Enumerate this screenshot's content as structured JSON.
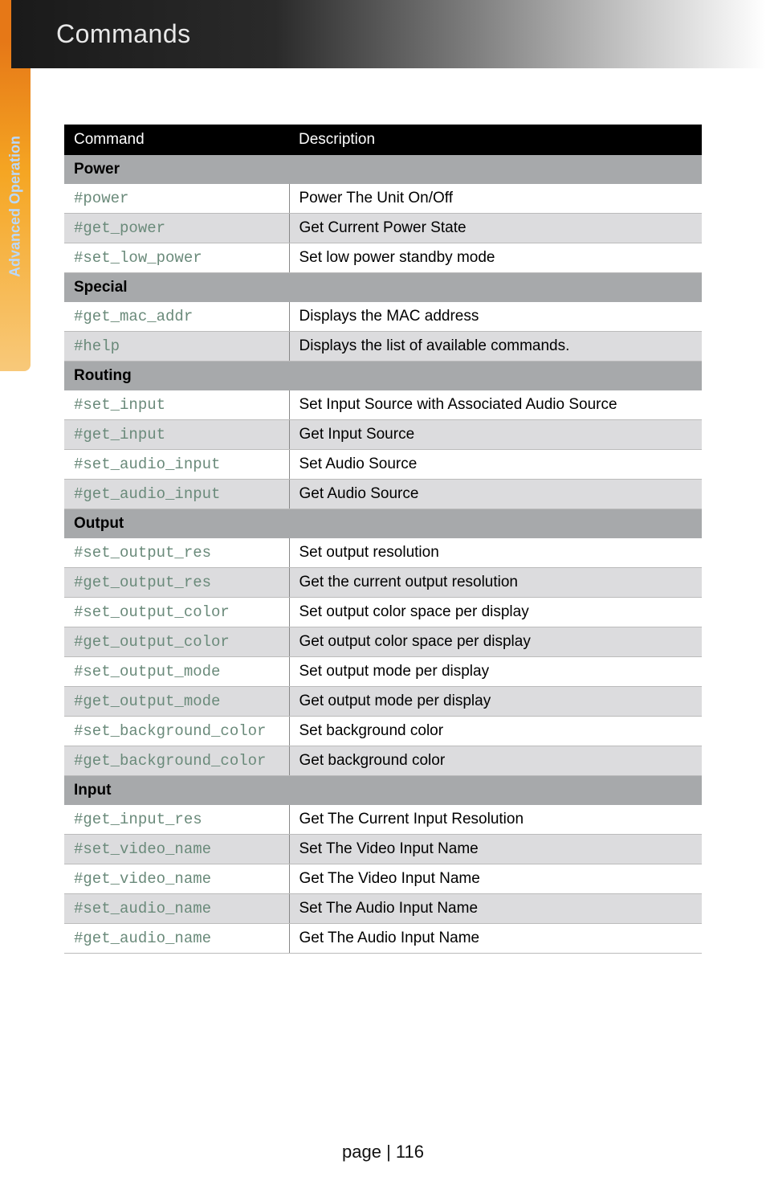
{
  "sidebar": {
    "label": "Advanced Operation"
  },
  "header": {
    "title": "Commands"
  },
  "table": {
    "headers": [
      "Command",
      "Description"
    ],
    "sections": [
      {
        "title": "Power",
        "rows": [
          {
            "cmd": "#power",
            "desc": "Power The Unit On/Off"
          },
          {
            "cmd": "#get_power",
            "desc": "Get Current Power State"
          },
          {
            "cmd": "#set_low_power",
            "desc": "Set low power standby mode"
          }
        ]
      },
      {
        "title": "Special",
        "rows": [
          {
            "cmd": "#get_mac_addr",
            "desc": "Displays the MAC address"
          },
          {
            "cmd": "#help",
            "desc": "Displays the list of available commands."
          }
        ]
      },
      {
        "title": "Routing",
        "rows": [
          {
            "cmd": "#set_input",
            "desc": "Set Input Source with Associated Audio Source"
          },
          {
            "cmd": "#get_input",
            "desc": "Get Input Source"
          },
          {
            "cmd": "#set_audio_input",
            "desc": "Set Audio Source"
          },
          {
            "cmd": "#get_audio_input",
            "desc": "Get Audio Source"
          }
        ]
      },
      {
        "title": "Output",
        "rows": [
          {
            "cmd": "#set_output_res",
            "desc": "Set output resolution"
          },
          {
            "cmd": "#get_output_res",
            "desc": "Get the current output resolution"
          },
          {
            "cmd": "#set_output_color",
            "desc": "Set output color space per display"
          },
          {
            "cmd": "#get_output_color",
            "desc": "Get output color space per display"
          },
          {
            "cmd": "#set_output_mode",
            "desc": "Set output mode per display"
          },
          {
            "cmd": "#get_output_mode",
            "desc": "Get output mode per display"
          },
          {
            "cmd": "#set_background_color",
            "desc": "Set background color"
          },
          {
            "cmd": "#get_background_color",
            "desc": "Get background color"
          }
        ]
      },
      {
        "title": "Input",
        "rows": [
          {
            "cmd": "#get_input_res",
            "desc": "Get The Current Input Resolution"
          },
          {
            "cmd": "#set_video_name",
            "desc": "Set The Video Input Name"
          },
          {
            "cmd": "#get_video_name",
            "desc": "Get The Video Input Name"
          },
          {
            "cmd": "#set_audio_name",
            "desc": "Set The Audio Input Name"
          },
          {
            "cmd": "#get_audio_name",
            "desc": "Get The Audio Input Name"
          }
        ]
      }
    ]
  },
  "footer": {
    "text": "page | 116"
  }
}
